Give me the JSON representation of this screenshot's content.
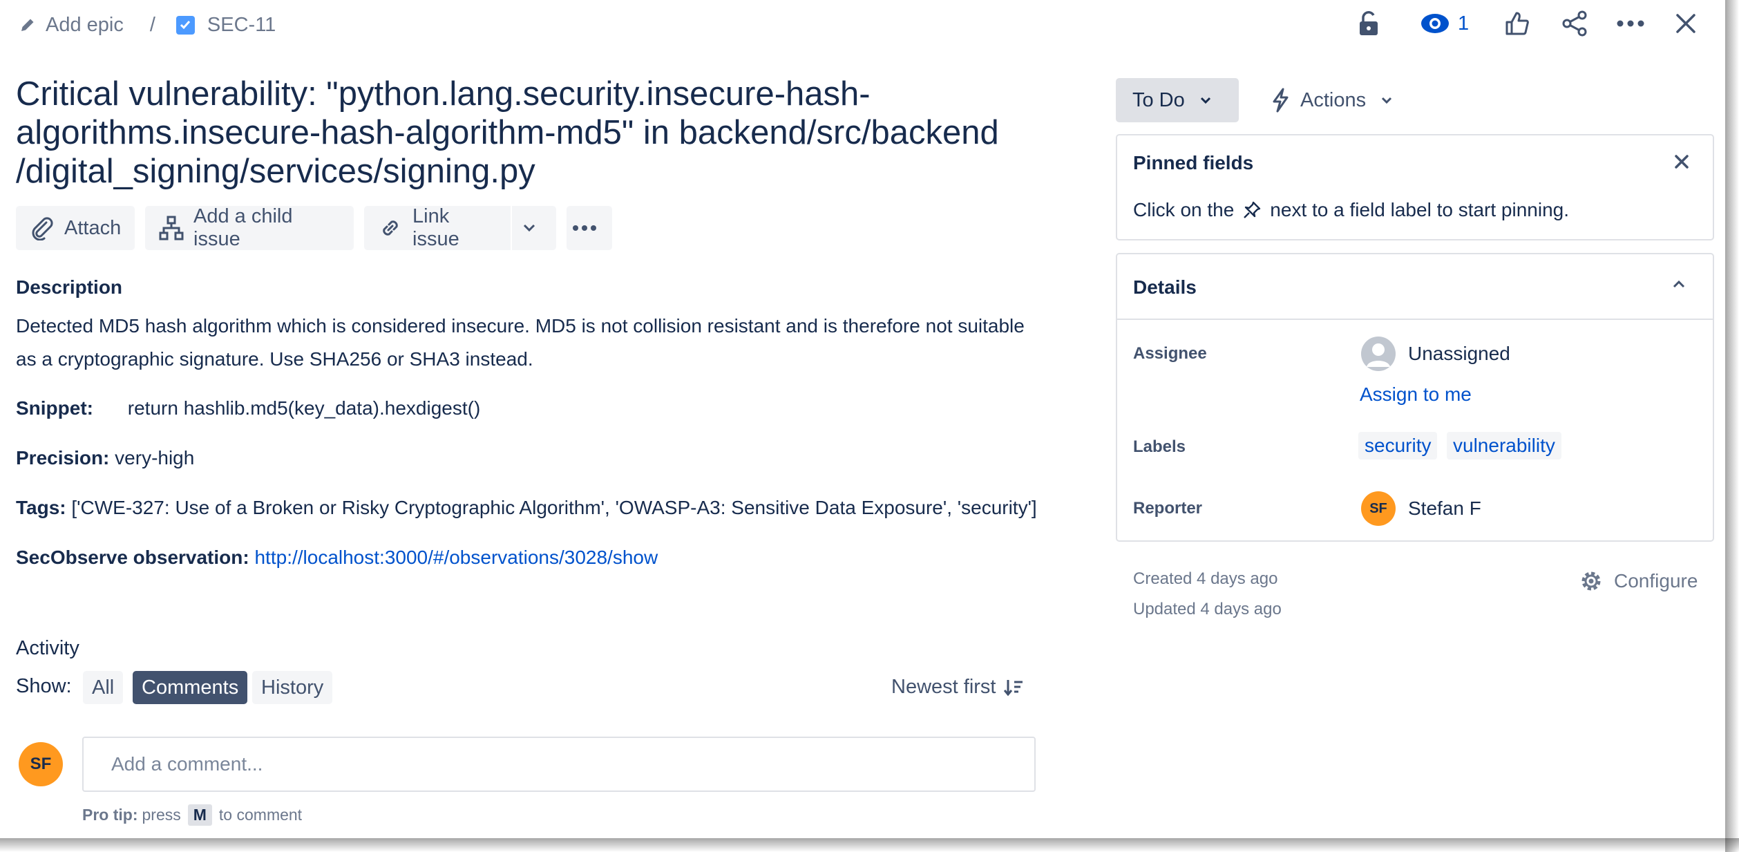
{
  "breadcrumb": {
    "epic_label": "Add epic",
    "separator": "/",
    "issue_key": "SEC-11"
  },
  "header_actions": {
    "watch_count": "1"
  },
  "issue": {
    "title_line1": "Critical vulnerability: \"python.lang.security.insecure-hash-",
    "title_line2": "algorithms.insecure-hash-algorithm-md5\" in backend/src/backend",
    "title_line3": "/digital_signing/services/signing.py"
  },
  "toolbar": {
    "attach": "Attach",
    "add_child": "Add a child issue",
    "link_issue": "Link issue"
  },
  "description": {
    "heading": "Description",
    "line1": "Detected MD5 hash algorithm which is considered insecure. MD5 is not collision resistant and is therefore not suitable",
    "line2": "as a cryptographic signature. Use SHA256 or SHA3 instead.",
    "snippet_label": "Snippet:",
    "snippet_value": "return hashlib.md5(key_data).hexdigest()",
    "precision_label": "Precision:",
    "precision_value": "very-high",
    "tags_label": "Tags:",
    "tags_value": "['CWE-327: Use of a Broken or Risky Cryptographic Algorithm', 'OWASP-A3: Sensitive Data Exposure', 'security']",
    "observation_label": "SecObserve observation:",
    "observation_link": "http://localhost:3000/#/observations/3028/show"
  },
  "activity": {
    "heading": "Activity",
    "show_label": "Show:",
    "filters": [
      "All",
      "Comments",
      "History"
    ],
    "active_filter": "Comments",
    "sort_label": "Newest first",
    "avatar_initials": "SF",
    "comment_placeholder": "Add a comment...",
    "pro_tip_label": "Pro tip:",
    "pro_tip_press": "press",
    "pro_tip_key": "M",
    "pro_tip_suffix": "to comment"
  },
  "status": {
    "label": "To Do"
  },
  "actions": {
    "label": "Actions"
  },
  "pinned": {
    "title": "Pinned fields",
    "hint_before": "Click on the",
    "hint_after": "next to a field label to start pinning."
  },
  "details": {
    "title": "Details",
    "assignee_label": "Assignee",
    "assignee_value": "Unassigned",
    "assign_to_me": "Assign to me",
    "labels_label": "Labels",
    "labels": [
      "security",
      "vulnerability"
    ],
    "reporter_label": "Reporter",
    "reporter_initials": "SF",
    "reporter_name": "Stefan F"
  },
  "meta": {
    "created": "Created 4 days ago",
    "updated": "Updated 4 days ago",
    "configure": "Configure"
  },
  "colors": {
    "text": "#172B4D",
    "link": "#0052CC",
    "subtle": "#6B778C",
    "avatar": "#FF991F",
    "active_filter": "#42526E",
    "button_bg": "#F4F5F7"
  }
}
